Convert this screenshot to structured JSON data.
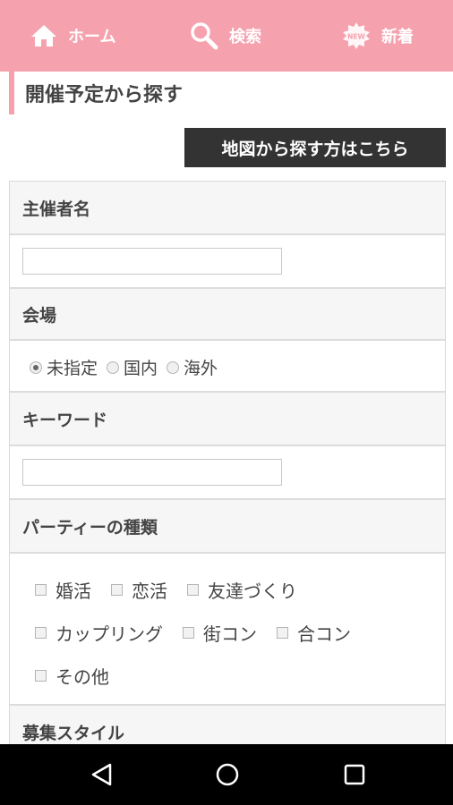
{
  "topnav": {
    "items": [
      {
        "label": "ホーム",
        "icon": "home-icon"
      },
      {
        "label": "検索",
        "icon": "search-icon"
      },
      {
        "label": "新着",
        "icon": "new-badge-icon"
      }
    ],
    "new_badge_text": "NEW"
  },
  "section": {
    "title": "開催予定から探す"
  },
  "map_button": {
    "label": "地図から探す方はこちら"
  },
  "form": {
    "organizer": {
      "label": "主催者名",
      "value": "",
      "placeholder": ""
    },
    "venue": {
      "label": "会場",
      "options": [
        "未指定",
        "国内",
        "海外"
      ],
      "selected": "未指定"
    },
    "keyword": {
      "label": "キーワード",
      "value": "",
      "placeholder": ""
    },
    "party_type": {
      "label": "パーティーの種類",
      "options": [
        "婚活",
        "恋活",
        "友達づくり",
        "カップリング",
        "街コン",
        "合コン",
        "その他"
      ]
    },
    "style": {
      "label": "募集スタイル"
    }
  },
  "colors": {
    "accent": "#f6a1ae",
    "button_bg": "#333333",
    "system_bar": "#000000"
  }
}
